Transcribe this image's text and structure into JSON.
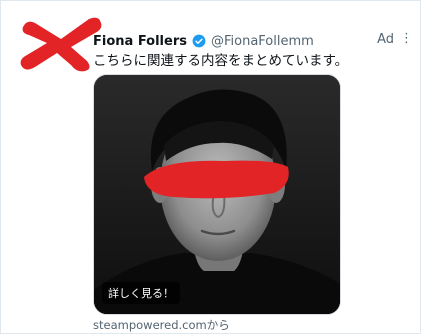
{
  "tweet": {
    "display_name": "Fiona Follers",
    "handle": "@FionaFollemm",
    "ad_label": "Ad",
    "more_icon": "more-vertical-icon",
    "text": "こちらに関連する内容をまとめています。",
    "media": {
      "cta_label": "詳しく見る！",
      "image_kind": "grayscale-portrait-photo",
      "redaction_color": "#e32427"
    },
    "domain_label": "steampowered.comから"
  },
  "colors": {
    "verified_blue": "#1d9bf0",
    "redaction_red": "#e32427",
    "secondary_text": "#536471"
  }
}
